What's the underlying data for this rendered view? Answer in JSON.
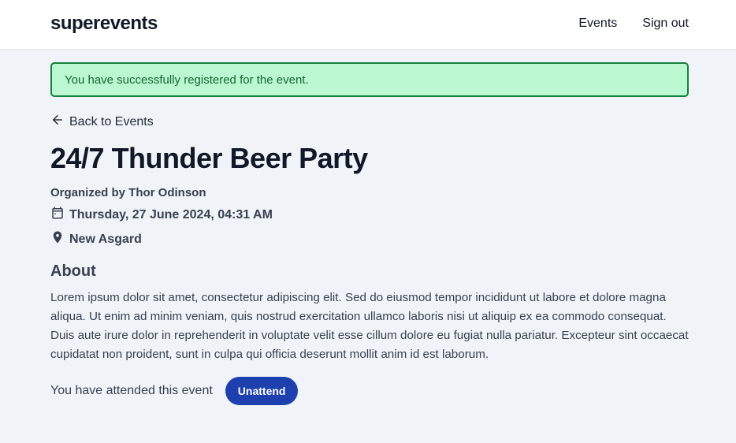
{
  "header": {
    "brand": "superevents",
    "nav": {
      "events_label": "Events",
      "signout_label": "Sign out"
    }
  },
  "alert": {
    "message": "You have successfully registered for the event.",
    "color": "#bbf7d0"
  },
  "back_link": {
    "icon": "arrow-left-icon",
    "label": "Back to Events"
  },
  "event": {
    "title": "24/7 Thunder Beer Party",
    "organizer": "Organized by Thor Odinson",
    "date": {
      "icon": "calendar-icon",
      "text": "Thursday, 27 June 2024, 04:31 AM"
    },
    "location": {
      "icon": "map-pin-icon",
      "text": "New Asgard"
    },
    "about_heading": "About",
    "about_text": "Lorem ipsum dolor sit amet, consectetur adipiscing elit. Sed do eiusmod tempor incididunt ut labore et dolore magna aliqua. Ut enim ad minim veniam, quis nostrud exercitation ullamco laboris nisi ut aliquip ex ea commodo consequat. Duis aute irure dolor in reprehenderit in voluptate velit esse cillum dolore eu fugiat nulla pariatur. Excepteur sint occaecat cupidatat non proident, sunt in culpa qui officia deserunt mollit anim id est laborum."
  },
  "attendance": {
    "status_text": "You have attended this event",
    "button_label": "Unattend",
    "button_color": "#1e40af"
  }
}
